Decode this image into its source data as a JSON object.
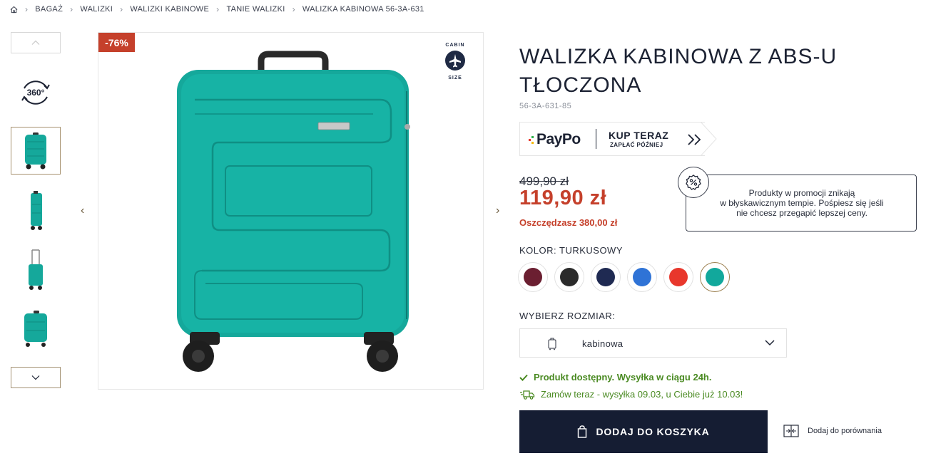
{
  "breadcrumb": {
    "items": [
      "BAGAŻ",
      "WALIZKI",
      "WALIZKI KABINOWE",
      "TANIE WALIZKI",
      "WALIZKA KABINOWA 56-3A-631"
    ]
  },
  "gallery": {
    "view_360_label": "360°",
    "discount_badge": "-76%",
    "cabin_badge": {
      "top": "CABIN",
      "bottom": "SIZE"
    }
  },
  "product": {
    "title": "WALIZKA KABINOWA Z ABS-U TŁOCZONA",
    "sku": "56-3A-631-85",
    "old_price": "499,90 zł",
    "price": "119,90 zł",
    "savings": "Oszczędzasz 380,00 zł"
  },
  "paypo": {
    "logo": "PayPo",
    "cta": "KUP TERAZ",
    "sub": "ZAPŁAĆ PÓŹNIEJ"
  },
  "promo": {
    "line1": "Produkty w promocji znikają",
    "line2": "w błyskawicznym tempie. Pośpiesz się jeśli",
    "line3": "nie chcesz przegapić lepszej ceny."
  },
  "color": {
    "label": "KOLOR: TURKUSOWY",
    "swatches": [
      "#6b1f31",
      "#2b2b2b",
      "#1f2a52",
      "#2f73d6",
      "#e8372c",
      "#12a89c"
    ],
    "selected_index": 5
  },
  "size": {
    "label": "WYBIERZ ROZMIAR:",
    "value": "kabinowa"
  },
  "availability": {
    "stock": "Produkt dostępny. Wysyłka w ciągu 24h.",
    "shipping": "Zamów teraz - wysyłka 09.03, u Ciebie już 10.03!"
  },
  "actions": {
    "add_to_cart": "DODAJ DO KOSZYKA",
    "compare": "Dodaj do porównania"
  },
  "colors": {
    "accent_red": "#c5402b",
    "dark_navy": "#151d33",
    "stock_green": "#4a8a22",
    "suitcase": "#15a89b"
  }
}
